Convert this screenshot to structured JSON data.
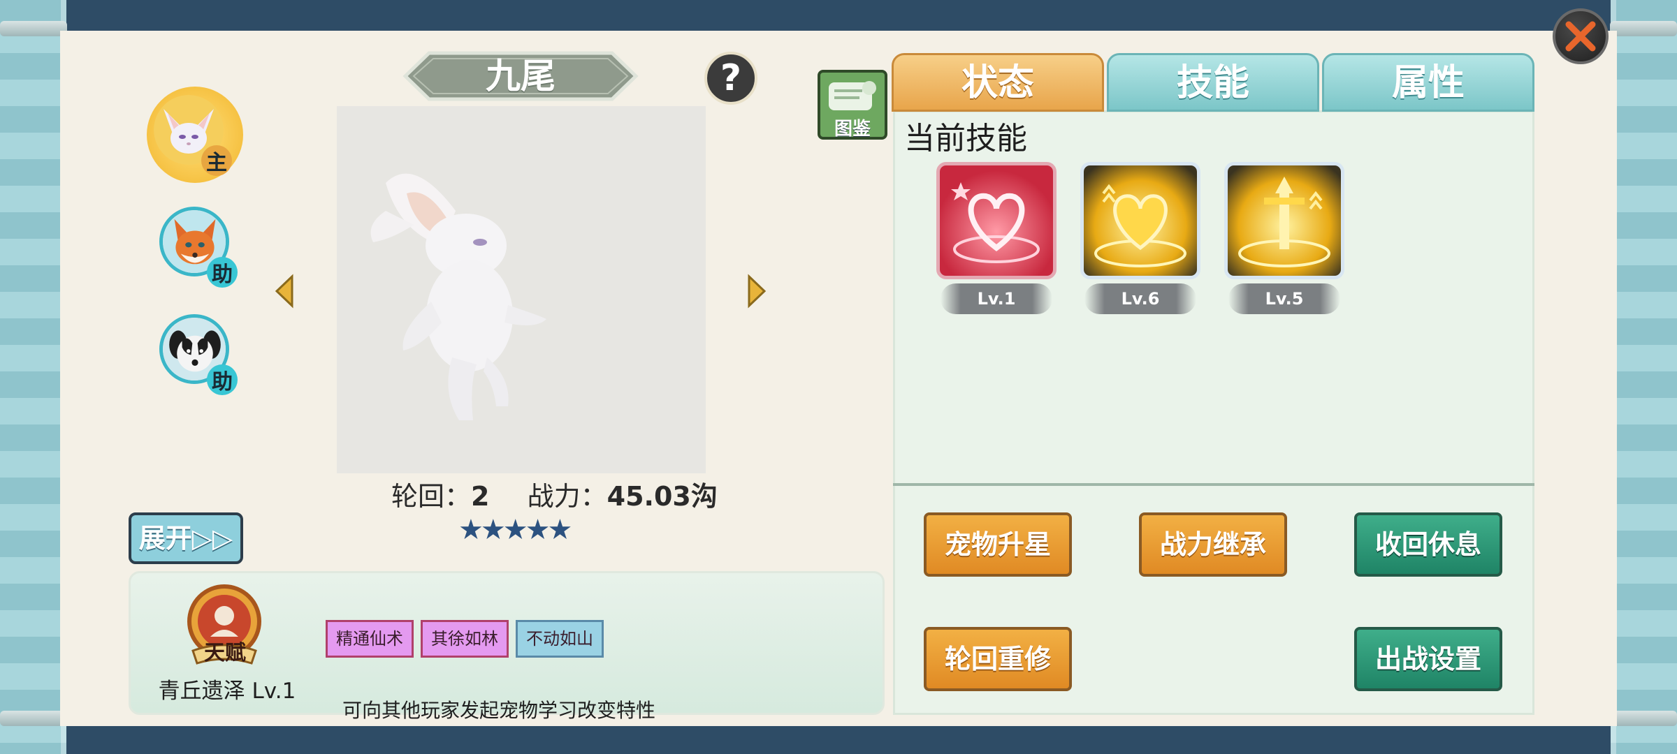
{
  "pet": {
    "name": "九尾",
    "reincarnation_label": "轮回：",
    "reincarnation_value": "2",
    "power_label": "战力：",
    "power_value": "45.03沟",
    "stars": "★★★★★"
  },
  "pet_list": [
    {
      "role": "主"
    },
    {
      "role": "助"
    },
    {
      "role": "助"
    }
  ],
  "buttons": {
    "help": "?",
    "expand": "展开▷▷",
    "codex": "图鉴"
  },
  "tabs": [
    {
      "label": "状态",
      "active": true
    },
    {
      "label": "技能",
      "active": false
    },
    {
      "label": "属性",
      "active": false
    }
  ],
  "skills": {
    "heading": "当前技能",
    "items": [
      {
        "level": "Lv.1",
        "icon": "heart-skill-icon",
        "color": "#d43a54"
      },
      {
        "level": "Lv.6",
        "icon": "golden-heart-skill-icon",
        "color": "#e8b21c"
      },
      {
        "level": "Lv.5",
        "icon": "sword-skill-icon",
        "color": "#e8b21c"
      }
    ]
  },
  "actions": {
    "star_up": "宠物升星",
    "inherit_power": "战力继承",
    "recall_rest": "收回休息",
    "reincarnate": "轮回重修",
    "battle_settings": "出战设置"
  },
  "talent": {
    "emblem_text": "天赋",
    "name": "青丘遗泽 Lv.1",
    "traits": [
      {
        "label": "精通仙术",
        "color": "#e08ae8"
      },
      {
        "label": "其徐如林",
        "color": "#e08ae8"
      },
      {
        "label": "不动如山",
        "color": "#8ccce0"
      }
    ],
    "hint": "可向其他玩家发起宠物学习改变特性"
  },
  "colors": {
    "tab_active": "#e8a54b",
    "tab_inactive": "#7cc6c8",
    "button_orange": "#e08a24",
    "button_green": "#1f8466",
    "star": "#2c5280"
  }
}
